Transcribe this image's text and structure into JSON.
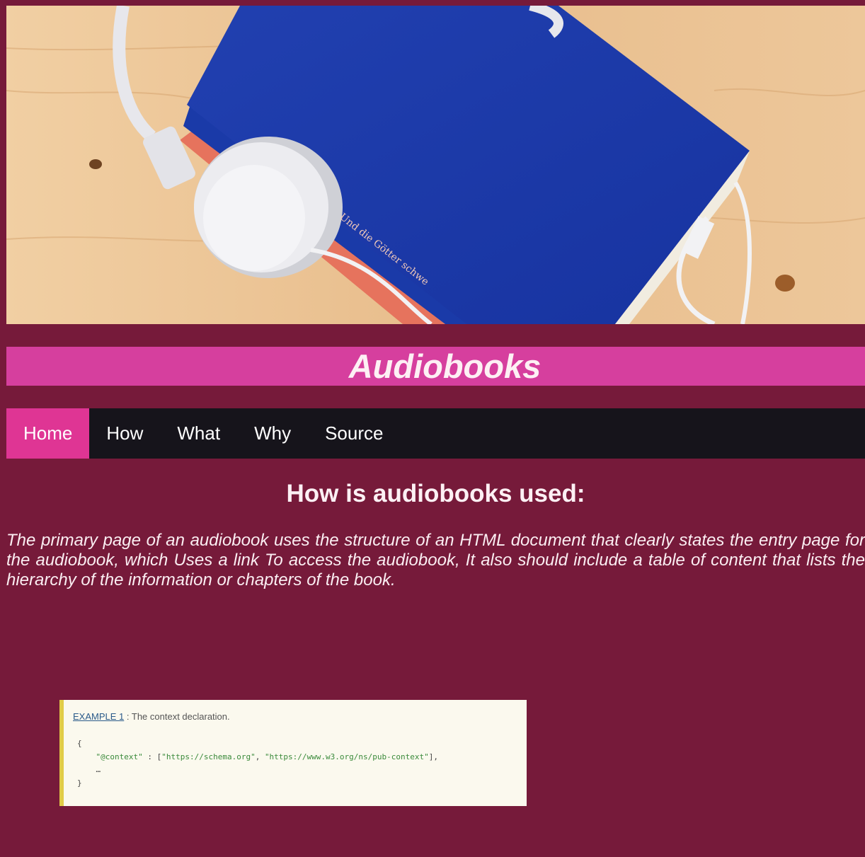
{
  "hero": {
    "image_alt": "Blue book with white headphones on a wooden table",
    "book_spine_text": "Und die Götter schwe"
  },
  "header": {
    "title": "Audiobooks"
  },
  "nav": {
    "items": [
      {
        "label": "Home",
        "active": true
      },
      {
        "label": "How",
        "active": false
      },
      {
        "label": "What",
        "active": false
      },
      {
        "label": "Why",
        "active": false
      },
      {
        "label": "Source",
        "active": false
      }
    ]
  },
  "main": {
    "heading": "How is audiobooks used:",
    "paragraph": "The primary page of an audiobook uses the structure of an HTML document that clearly states the entry page for the audiobook, which Uses a link To access the audiobook, It also should include a table of content that lists the hierarchy of the information or chapters of the book."
  },
  "example": {
    "link_label": "EXAMPLE 1",
    "separator": " : ",
    "caption": "The context declaration.",
    "code_open": "{",
    "code_key": "\"@context\"",
    "code_colon": " : [",
    "code_val1": "\"https://schema.org\"",
    "code_comma": ", ",
    "code_val2": "\"https://www.w3.org/ns/pub-context\"",
    "code_end": "],",
    "code_ellipsis": "…",
    "code_close": "}"
  },
  "colors": {
    "background": "#761a3a",
    "title_bar": "#d63f9e",
    "nav_bg": "#16141b",
    "nav_active": "#df3594",
    "example_border": "#e1cc47"
  }
}
